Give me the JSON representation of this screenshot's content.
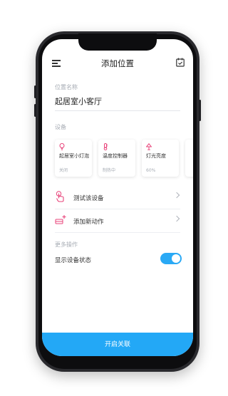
{
  "header": {
    "title": "添加位置",
    "menu_icon": "menu-icon",
    "right_icon": "calendar-check-icon"
  },
  "location": {
    "label": "位置名称",
    "value": "起居室小客厅"
  },
  "devices": {
    "label": "设备",
    "items": [
      {
        "name": "起居室小灯泡",
        "status": "关闭",
        "icon": "bulb-icon",
        "icon_color": "#e8437a"
      },
      {
        "name": "温度控制器",
        "status": "制热中",
        "icon": "thermometer-icon",
        "icon_color": "#e8437a"
      },
      {
        "name": "灯光亮度",
        "status": "60%",
        "icon": "lamp-icon",
        "icon_color": "#e8437a"
      }
    ]
  },
  "actions": [
    {
      "label": "测试该设备",
      "icon": "hand-tap-icon"
    },
    {
      "label": "添加新动作",
      "icon": "add-action-icon"
    }
  ],
  "more": {
    "label": "更多操作",
    "toggle_label": "显示设备状态",
    "toggle_on": true
  },
  "footer": {
    "button_label": "开启关联"
  },
  "colors": {
    "accent": "#23a8f6",
    "icon_pink": "#e8437a"
  }
}
